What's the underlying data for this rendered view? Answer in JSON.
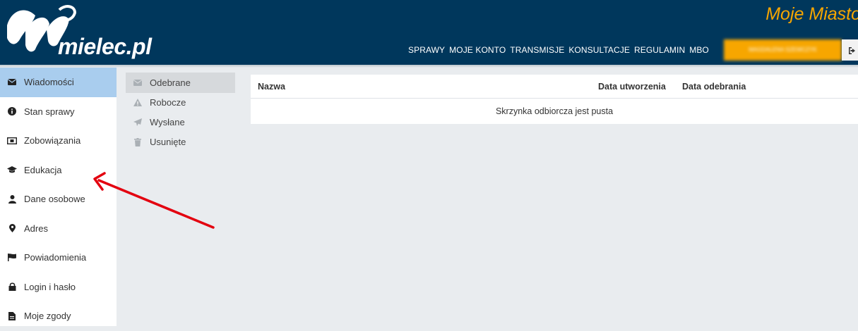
{
  "header": {
    "logo_text": "mielec.pl",
    "brand_title": "Moje Miasto",
    "nav": [
      "SPRAWY",
      "MOJE KONTO",
      "TRANSMISJE",
      "KONSULTACJE",
      "REGULAMIN",
      "MBO"
    ],
    "user_name": "MAGDALENA SZEWCZYK",
    "logout_icon": "sign-out-icon"
  },
  "sidebar": {
    "items": [
      {
        "label": "Wiadomości",
        "icon": "envelope-icon",
        "active": true
      },
      {
        "label": "Stan sprawy",
        "icon": "info-circle-icon"
      },
      {
        "label": "Zobowiązania",
        "icon": "money-icon"
      },
      {
        "label": "Edukacja",
        "icon": "graduation-cap-icon"
      },
      {
        "label": "Dane osobowe",
        "icon": "user-icon"
      },
      {
        "label": "Adres",
        "icon": "map-marker-icon"
      },
      {
        "label": "Powiadomienia",
        "icon": "flag-icon"
      },
      {
        "label": "Login i hasło",
        "icon": "lock-icon"
      },
      {
        "label": "Moje zgody",
        "icon": "file-icon"
      }
    ]
  },
  "folders": [
    {
      "label": "Odebrane",
      "icon": "envelope-icon",
      "active": true
    },
    {
      "label": "Robocze",
      "icon": "warning-icon"
    },
    {
      "label": "Wysłane",
      "icon": "paper-plane-icon"
    },
    {
      "label": "Usunięte",
      "icon": "trash-icon"
    }
  ],
  "table": {
    "columns": [
      "Nazwa",
      "Data utworzenia",
      "Data odebrania"
    ],
    "empty_message": "Skrzynka odbiorcza jest pusta"
  },
  "colors": {
    "header_bg": "#00375c",
    "accent_orange": "#f7a600",
    "active_sidebar": "#a9cdee",
    "arrow": "#e3000f"
  }
}
